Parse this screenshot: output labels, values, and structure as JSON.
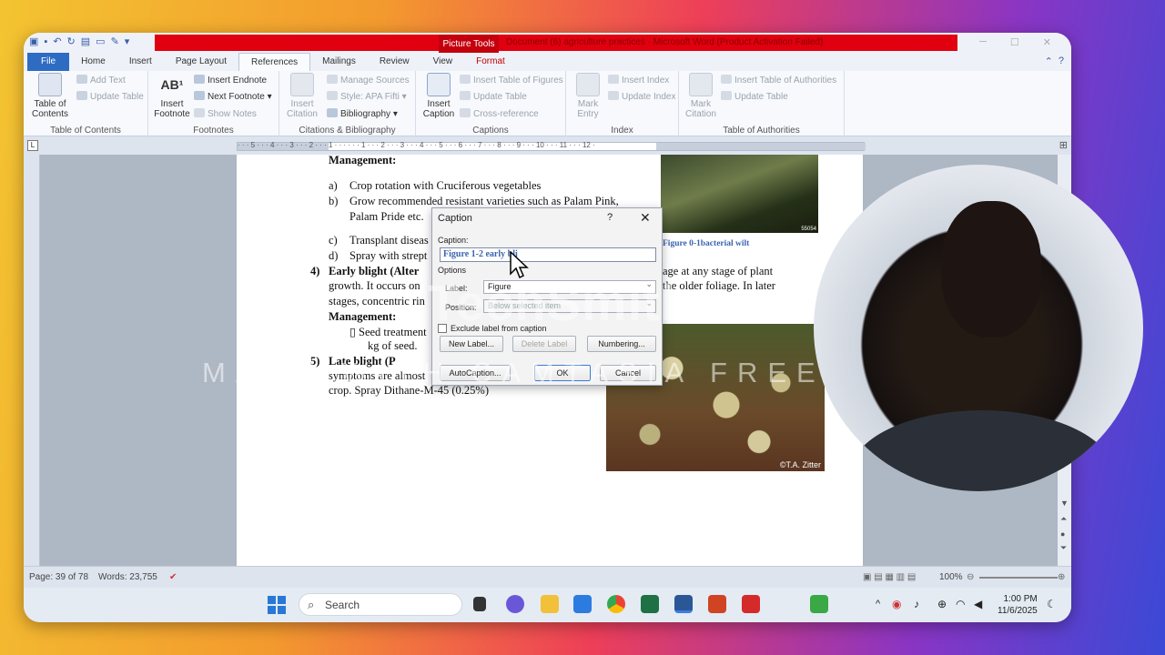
{
  "window": {
    "picture_tools": "Picture Tools",
    "title": "Document (6) agriculture practices - Microsoft Word (Product Activation Failed)"
  },
  "tabs": [
    "File",
    "Home",
    "Insert",
    "Page Layout",
    "References",
    "Mailings",
    "Review",
    "View",
    "Format"
  ],
  "ribbon": {
    "toc": {
      "toc_label": "Table of\nContents",
      "add_text": "Add Text",
      "update_table": "Update Table",
      "group": "Table of Contents"
    },
    "footnotes": {
      "insert_footnote": "Insert\nFootnote",
      "insert_endnote": "Insert Endnote",
      "next_footnote": "Next Footnote",
      "show_notes": "Show Notes",
      "group": "Footnotes"
    },
    "citations": {
      "insert_citation": "Insert\nCitation",
      "manage_sources": "Manage Sources",
      "style_label": "Style:",
      "style_value": "APA Fifti",
      "bibliography": "Bibliography",
      "group": "Citations & Bibliography"
    },
    "captions": {
      "insert_caption": "Insert\nCaption",
      "insert_tof": "Insert Table of Figures",
      "update_table": "Update Table",
      "cross_reference": "Cross-reference",
      "group": "Captions"
    },
    "index": {
      "mark_entry": "Mark\nEntry",
      "insert_index": "Insert Index",
      "update_index": "Update Index",
      "group": "Index"
    },
    "authorities": {
      "mark_citation": "Mark\nCitation",
      "insert_toa": "Insert Table of Authorities",
      "update_table": "Update Table",
      "group": "Table of Authorities"
    }
  },
  "ruler_numbers": "· · · 5 · · · 4 · · · 3 · · · 2 · · · 1 · · · · · · 1 · · · 2 · · · 3 · · · 4 · · · 5 · · · 6 · · · 7 · · · 8 · · · 9 · · · 10 · · · 11 · · · 12 ·",
  "document": {
    "mgmt1": "Management:",
    "a_marker": "a)",
    "a_text": "Crop rotation with Cruciferous vegetables",
    "b_marker": "b)",
    "b_text": "Grow recommended resistant varieties such as Palam Pink,",
    "b_text2": "Palam Pride etc.",
    "c_marker": "c)",
    "c_text": "Transplant diseas",
    "d_marker": "d)",
    "d_text": "Spray with strept",
    "item4_num": "4)",
    "item4_title": "Early blight (Alter",
    "growth_line": "growth. It occurs on",
    "stages_line": "stages, concentric rin",
    "mgmt2": "Management:",
    "seed_line": "▯ Seed treatment",
    "kg_line": "kg of seed.",
    "item5_num": "5)",
    "item5_title": "Late      blight  (P",
    "symptoms_line": "symptoms are almost",
    "crop_line": "crop. Spray Dithane-M-45 (0.25%)",
    "right1": "age at any stage of plant",
    "right2": "the older foliage. In later",
    "figure_caption": "Figure 0-1bacterial wilt",
    "img_code": "55054",
    "img_credit": "©T.A. Zitter"
  },
  "dialog": {
    "title": "Caption",
    "help": "?",
    "close": "✕",
    "caption_label": "Caption:",
    "caption_value": "Figure 1-2 early bli",
    "options_label": "Options",
    "label_label": "Label:",
    "label_value": "Figure",
    "position_label": "Position:",
    "position_value": "Below selected item",
    "exclude_label": "Exclude label from caption",
    "new_label": "New Label...",
    "delete_label": "Delete Label",
    "numbering": "Numbering...",
    "autocaption": "AutoCaption...",
    "ok": "OK",
    "cancel": "Cancel"
  },
  "watermark": {
    "logo": "TechSmith",
    "line": "MADE WITH CAMTASIA FREE TRIAL"
  },
  "statusbar": {
    "page": "Page: 39 of 78",
    "words": "Words: 23,755",
    "zoom": "100%"
  },
  "taskbar": {
    "search_placeholder": "Search",
    "time": "1:00 PM",
    "date": "11/6/2025"
  }
}
